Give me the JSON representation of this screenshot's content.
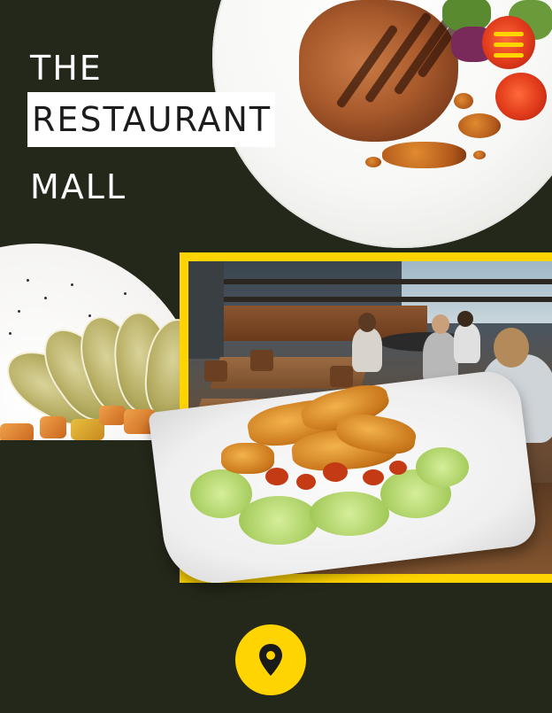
{
  "hero": {
    "title_line1": "THE",
    "title_line2": "RESTAURANT",
    "title_line3": "MALL"
  },
  "header": {
    "menu_icon": "hamburger-menu-icon"
  },
  "footer": {
    "location_icon": "map-pin-icon"
  },
  "colors": {
    "background": "#24281a",
    "accent": "#ffd400",
    "title_text": "#ffffff",
    "highlight_bg": "#ffffff"
  }
}
